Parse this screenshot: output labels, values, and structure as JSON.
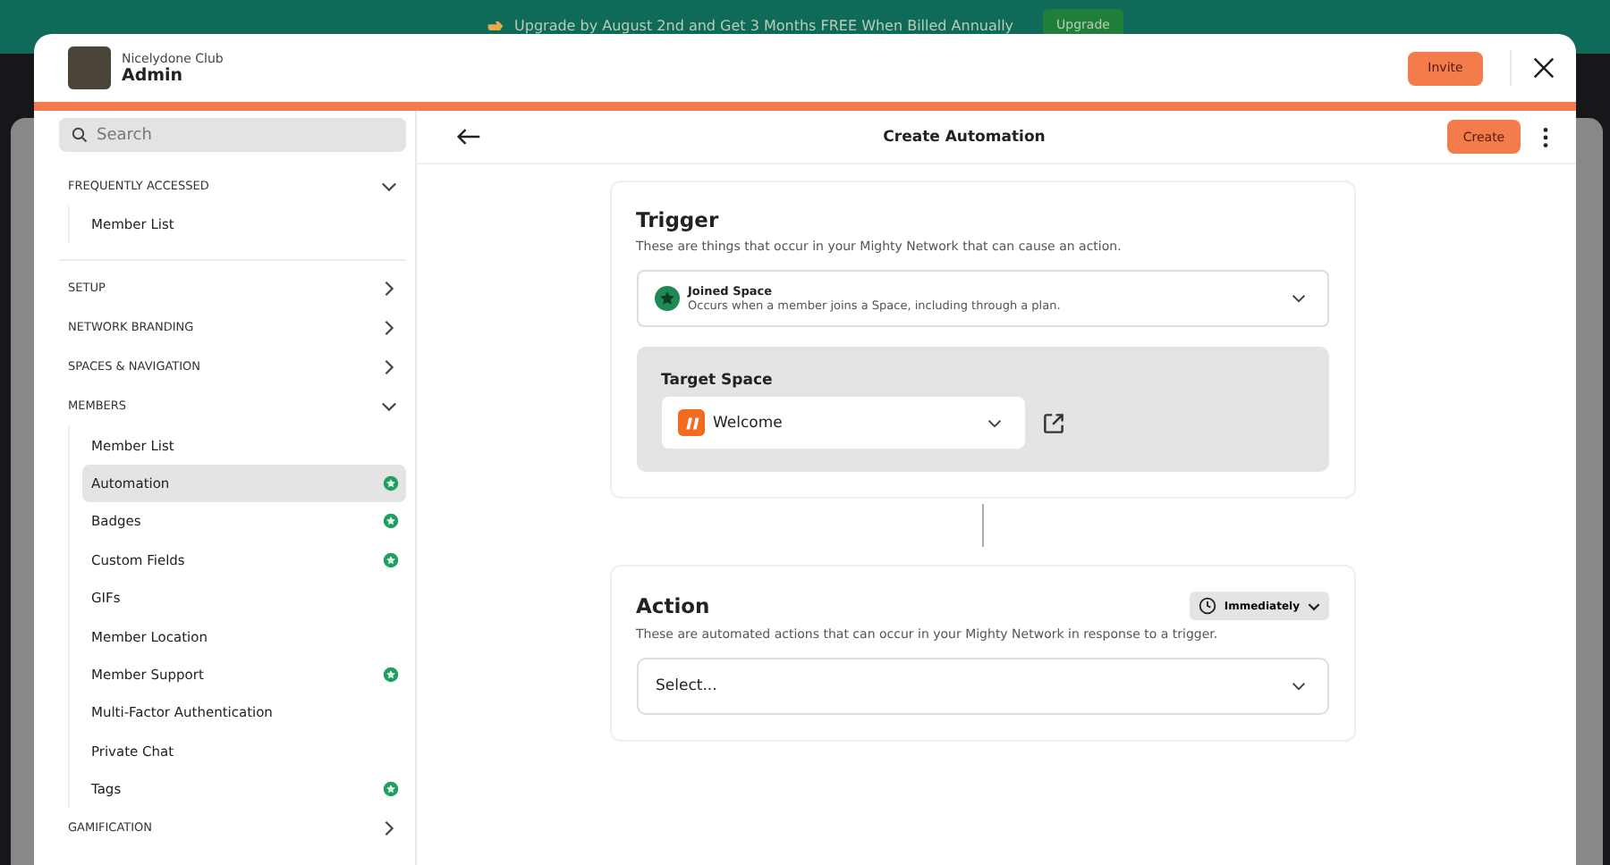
{
  "banner": {
    "text": "Upgrade by August 2nd and Get 3 Months FREE When Billed Annually",
    "button": "Upgrade"
  },
  "header": {
    "network": "Nicelydone Club",
    "title": "Admin",
    "invite": "Invite"
  },
  "sidebar": {
    "search": {
      "placeholder": "Search"
    },
    "sections": [
      {
        "title": "FREQUENTLY ACCESSED",
        "expanded": true,
        "items": [
          {
            "label": "Member List",
            "selected": false,
            "badge": false
          }
        ]
      },
      {
        "title": "SETUP",
        "expanded": false
      },
      {
        "title": "NETWORK BRANDING",
        "expanded": false
      },
      {
        "title": "SPACES & NAVIGATION",
        "expanded": false
      },
      {
        "title": "MEMBERS",
        "expanded": true,
        "items": [
          {
            "label": "Member List",
            "selected": false,
            "badge": false
          },
          {
            "label": "Automation",
            "selected": true,
            "badge": true
          },
          {
            "label": "Badges",
            "selected": false,
            "badge": true
          },
          {
            "label": "Custom Fields",
            "selected": false,
            "badge": true
          },
          {
            "label": "GIFs",
            "selected": false,
            "badge": false
          },
          {
            "label": "Member Location",
            "selected": false,
            "badge": false
          },
          {
            "label": "Member Support",
            "selected": false,
            "badge": true
          },
          {
            "label": "Multi-Factor Authentication",
            "selected": false,
            "badge": false
          },
          {
            "label": "Private Chat",
            "selected": false,
            "badge": false
          },
          {
            "label": "Tags",
            "selected": false,
            "badge": true
          }
        ]
      },
      {
        "title": "GAMIFICATION",
        "expanded": false
      }
    ]
  },
  "main": {
    "title": "Create Automation",
    "create": "Create",
    "trigger": {
      "title": "Trigger",
      "description": "These are things that occur in your Mighty Network that can cause an action.",
      "select": {
        "name": "Joined Space",
        "description": "Occurs when a member joins a Space, including through a plan."
      },
      "target_label": "Target Space",
      "target_value": "Welcome"
    },
    "action": {
      "title": "Action",
      "timing": "Immediately",
      "description": "These are automated actions that can occur in your Mighty Network in response to a trigger.",
      "select": {
        "placeholder": "Select..."
      }
    }
  }
}
